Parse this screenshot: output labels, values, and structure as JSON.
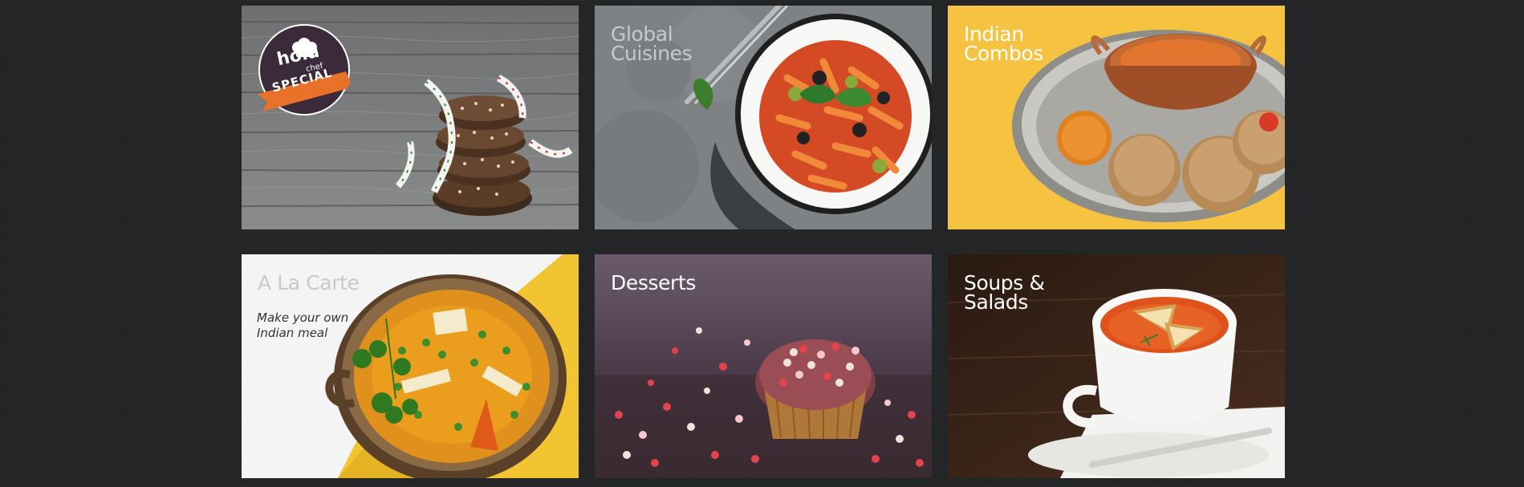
{
  "tiles": [
    {
      "title": "",
      "badge": {
        "brand": "hola",
        "brand_sub": "chef",
        "ribbon": "SPECIAL"
      }
    },
    {
      "title": "Global\nCuisines"
    },
    {
      "title": "Indian\nCombos"
    },
    {
      "title": "A La Carte",
      "subtitle": "Make your own\nIndian meal"
    },
    {
      "title": "Desserts"
    },
    {
      "title": "Soups &\nSalads"
    }
  ],
  "colors": {
    "background": "#242526",
    "badge_circle": "#3b2a3a",
    "ribbon": "#e8722a",
    "combos_bg": "#f6c340"
  }
}
